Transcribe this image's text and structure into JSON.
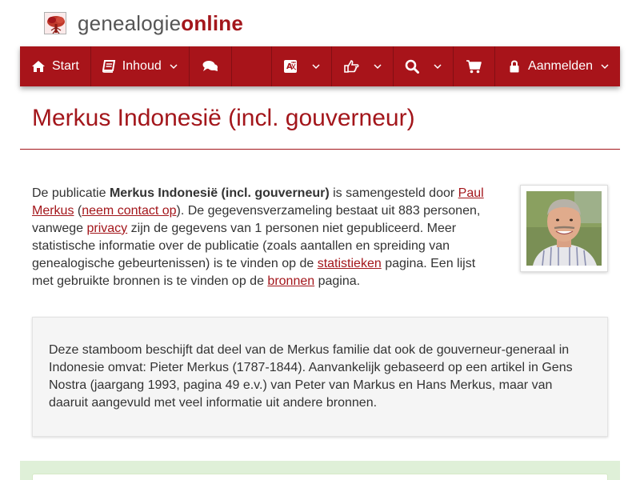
{
  "logo": {
    "text_part1": "genealogie",
    "text_part2": "online",
    "icon": "tree-logo-icon"
  },
  "navbar": {
    "start_label": "Start",
    "inhoud_label": "Inhoud",
    "login_label": "Aanmelden",
    "icons": [
      "home-icon",
      "book-icon",
      "comments-icon",
      "translate-icon",
      "hand-pointer-icon",
      "search-icon",
      "shopping-cart-icon",
      "lock-icon",
      "chevron-down-icon"
    ],
    "color": "#a8141a"
  },
  "page": {
    "title": "Merkus Indonesië (incl. gouverneur)"
  },
  "intro": {
    "p1": "De publicatie ",
    "pub_name": "Merkus Indonesië (incl. gouverneur)",
    "p2": " is samengesteld door ",
    "author": "Paul Merkus",
    "p3": " (",
    "contact_link": "neem contact op",
    "p4": "). De gegevensverzameling bestaat uit 883 personen, vanwege ",
    "privacy_link": "privacy",
    "p5": " zijn de gegevens van 1 personen niet gepubliceerd. Meer statistische informatie over de publicatie (zoals aantallen en spreiding van genealogische gebeurtenissen) is te vinden op de ",
    "stats_link": "statistieken",
    "p6": " pagina. Een lijst met gebruikte bronnen is te vinden op de ",
    "sources_link": "bronnen",
    "p7": " pagina."
  },
  "description": {
    "text": "Deze stamboom beschijft dat deel van de Merkus familie dat ook de gouverneur-generaal in Indonesie omvat: Pieter Merkus (1787-1844). Aanvankelijk gebaseerd op een artikel in Gens Nostra (jaargang 1993, pagina 49 e.v.) van Peter van Markus en Hans Merkus, maar van daaruit aangevuld met veel informatie uit andere bronnen."
  },
  "colors": {
    "brand": "#a3161b",
    "text": "#333333",
    "well_bg": "#f5f5f5",
    "success_bg": "#dff0d8"
  }
}
